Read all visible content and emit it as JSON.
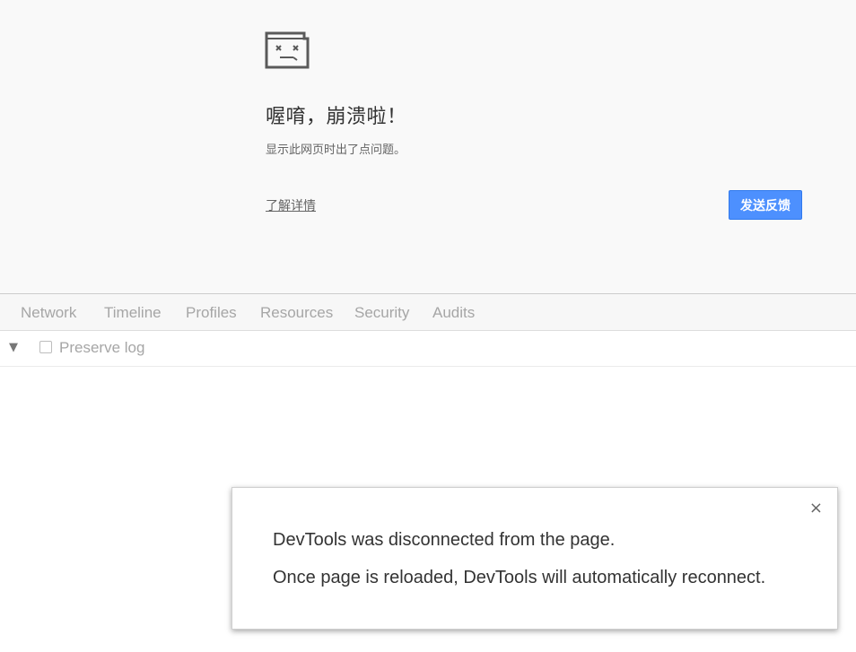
{
  "crash": {
    "icon": "sad-tab-icon",
    "title": "喔唷，崩溃啦！",
    "message": "显示此网页时出了点问题。",
    "learn_more": "了解详情",
    "feedback_button": "发送反馈"
  },
  "devtools": {
    "tabs": [
      "Network",
      "Timeline",
      "Profiles",
      "Resources",
      "Security",
      "Audits"
    ],
    "filter_icon": "filter-triangle-icon",
    "preserve_log_label": "Preserve log",
    "preserve_log_checked": false
  },
  "dialog": {
    "close_label": "×",
    "line1": "DevTools was disconnected from the page.",
    "line2": "Once page is reloaded, DevTools will automatically reconnect."
  },
  "colors": {
    "button_blue": "#4d90fe",
    "page_bg": "#f9f9f9"
  }
}
